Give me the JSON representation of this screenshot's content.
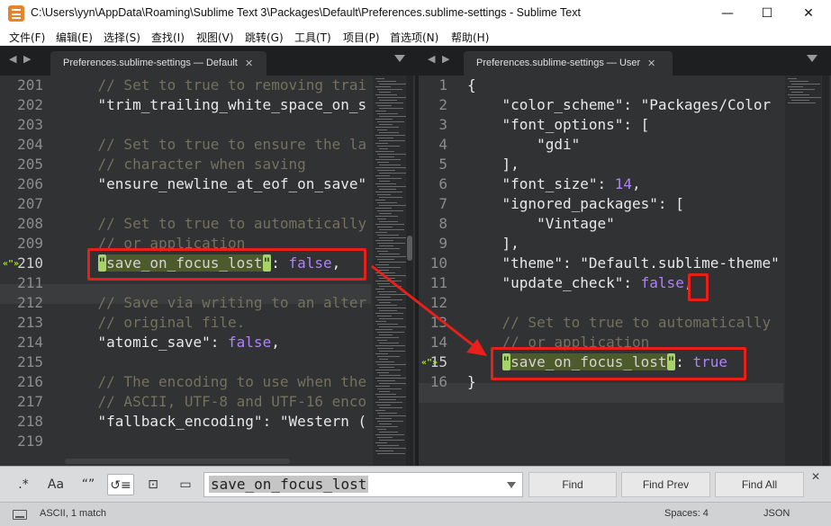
{
  "window": {
    "title": "C:\\Users\\yyn\\AppData\\Roaming\\Sublime Text 3\\Packages\\Default\\Preferences.sublime-settings - Sublime Text",
    "minimize_glyph": "—",
    "maximize_glyph": "☐",
    "close_glyph": "✕"
  },
  "menu": [
    "文件(F)",
    "编辑(E)",
    "选择(S)",
    "查找(I)",
    "视图(V)",
    "跳转(G)",
    "工具(T)",
    "项目(P)",
    "首选项(N)",
    "帮助(H)"
  ],
  "left_pane": {
    "nav": "◀ ▶",
    "tab_label": "Preferences.sublime-settings — Default",
    "tab_close": "✕",
    "line_numbers": [
      "201",
      "202",
      "203",
      "204",
      "205",
      "206",
      "207",
      "208",
      "209",
      "210",
      "211",
      "212",
      "213",
      "214",
      "215",
      "216",
      "217",
      "218",
      "219"
    ],
    "current_line": "210",
    "marker": "«\"»",
    "lines": [
      "    // Set to true to removing trai",
      "    \"trim_trailing_white_space_on_s",
      "",
      "    // Set to true to ensure the la",
      "    // character when saving",
      "    \"ensure_newline_at_eof_on_save\"",
      "",
      "    // Set to true to automatically",
      "    // or application",
      "    \"save_on_focus_lost\": false,",
      "",
      "    // Save via writing to an alter",
      "    // original file.",
      "    \"atomic_save\": false,",
      "",
      "    // The encoding to use when the",
      "    // ASCII, UTF-8 and UTF-16 enco",
      "    \"fallback_encoding\": \"Western (",
      ""
    ]
  },
  "right_pane": {
    "nav": "◀ ▶",
    "tab_label": "Preferences.sublime-settings — User",
    "tab_close": "✕",
    "line_numbers": [
      "1",
      "2",
      "3",
      "4",
      "5",
      "6",
      "7",
      "8",
      "9",
      "10",
      "11",
      "12",
      "13",
      "14",
      "15",
      "16"
    ],
    "current_line": "15",
    "marker": "«\"»",
    "lines": [
      "{",
      "    \"color_scheme\": \"Packages/Color",
      "    \"font_options\": [",
      "        \"gdi\"",
      "    ],",
      "    \"font_size\": 14,",
      "    \"ignored_packages\": [",
      "        \"Vintage\"",
      "    ],",
      "    \"theme\": \"Default.sublime-theme\"",
      "    \"update_check\": false,",
      "",
      "    // Set to true to automatically",
      "    // or application",
      "    \"save_on_focus_lost\": true",
      "}"
    ]
  },
  "find_panel": {
    "regex_toggle": ".*",
    "case_toggle": "Aa",
    "word_toggle": "“”",
    "wrap_toggle": "↺≡",
    "selection_toggle": "⊡",
    "highlight_toggle": "▭",
    "query": "save_on_focus_lost",
    "find_label": "Find",
    "find_prev_label": "Find Prev",
    "find_all_label": "Find All",
    "close_glyph": "✕"
  },
  "status": {
    "left": "ASCII, 1 match",
    "spaces": "Spaces: 4",
    "syntax": "JSON"
  },
  "colors": {
    "annotation": "#e8201c",
    "match_highlight": "#a6d36a",
    "comment": "#75715e",
    "constant": "#ae81ff"
  }
}
